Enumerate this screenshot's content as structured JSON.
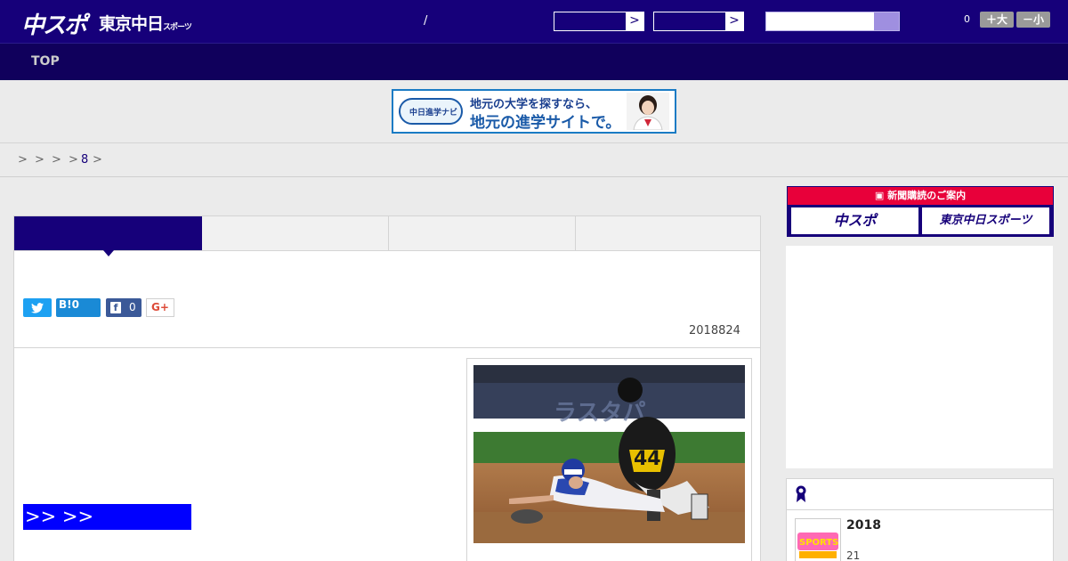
{
  "header": {
    "logo_chuspo": "中スポ",
    "logo_tokyo": "東京中日",
    "logo_tokyo_small": "スポーツ",
    "slash": "/",
    "select_arrow": ">",
    "font_count": "0",
    "font_larger": "＋大",
    "font_smaller": "－小"
  },
  "nav": {
    "top": "TOP"
  },
  "banner": {
    "logo_text": "中日進学ナビ",
    "line1": "地元の大学を探すなら、",
    "line2": "地元の進学サイトで。"
  },
  "breadcrumb": {
    "sep": ">",
    "link": "8"
  },
  "share": {
    "twitter_icon": "twitter-icon",
    "hatena": "B!0",
    "facebook_count": "0",
    "gplus": "G+"
  },
  "article": {
    "date": "2018824",
    "more_link": ">> >>"
  },
  "sidebar": {
    "subscribe_header": "新聞購読のご案内",
    "subscribe_chuspo": "中スポ",
    "subscribe_tokyo": "東京中日スポーツ",
    "ranking_title": "2018",
    "ranking_sub": "21"
  },
  "colors": {
    "brand_navy": "#16007a",
    "nav_navy": "#10005c",
    "subscribe_red": "#e8003a",
    "more_link_blue": "#0000ff"
  }
}
